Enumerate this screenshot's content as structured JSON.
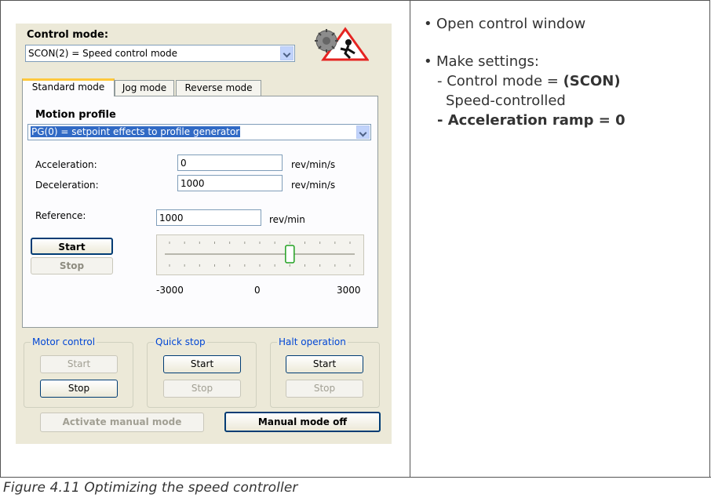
{
  "dialog": {
    "control_mode_label": "Control mode:",
    "control_mode_value": "SCON(2) = Speed control mode",
    "tabs": [
      "Standard mode",
      "Jog mode",
      "Reverse mode"
    ],
    "motion_profile_label": "Motion profile",
    "motion_profile_value": "PG(0) = setpoint effects to profile generator",
    "acceleration": {
      "label": "Acceleration:",
      "value": "0",
      "unit": "rev/min/s"
    },
    "deceleration": {
      "label": "Deceleration:",
      "value": "1000",
      "unit": "rev/min/s"
    },
    "reference": {
      "label": "Reference:",
      "value": "1000",
      "unit": "rev/min"
    },
    "start_label": "Start",
    "stop_label": "Stop",
    "slider": {
      "min_label": "-3000",
      "mid_label": "0",
      "max_label": "3000",
      "min": -3000,
      "max": 3000,
      "value": 1000
    },
    "groups": {
      "motor_control": {
        "title": "Motor control",
        "start": "Start",
        "stop": "Stop"
      },
      "quick_stop": {
        "title": "Quick stop",
        "start": "Start",
        "stop": "Stop"
      },
      "halt_operation": {
        "title": "Halt operation",
        "start": "Start",
        "stop": "Stop"
      }
    },
    "activate_manual_mode": "Activate manual mode",
    "manual_mode_off": "Manual mode off"
  },
  "notes": {
    "bullet1": "Open control window",
    "bullet2": "Make settings:",
    "sub1_prefix": "- Control mode = ",
    "sub1_bold": "(SCON)",
    "sub1_cont": "Speed-controlled",
    "sub2": "- Acceleration ramp = 0",
    "bullet_char": "•"
  },
  "caption": "Figure 4.11    Optimizing the speed controller",
  "colors": {
    "dialog_bg": "#ece9d8",
    "tab_highlight": "#ffc83c",
    "group_title": "#0046d5",
    "warning_red": "#e52421"
  },
  "icons": {
    "warning": "hazard-triangle-icon"
  }
}
